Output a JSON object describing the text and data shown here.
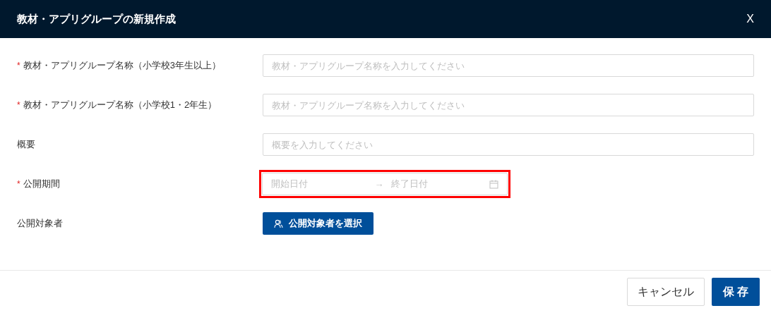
{
  "dialog": {
    "title": "教材・アプリグループの新規作成",
    "close": "X"
  },
  "fields": [
    {
      "kind": "text",
      "required_mark": "*",
      "label": "教材・アプリグループ名称（小学校3年生以上）",
      "placeholder": "教材・アプリグループ名称を入力してください"
    },
    {
      "kind": "text",
      "required_mark": "*",
      "label": "教材・アプリグループ名称（小学校1・2年生）",
      "placeholder": "教材・アプリグループ名称を入力してください"
    },
    {
      "kind": "text",
      "label": "概要",
      "placeholder": "概要を入力してください"
    },
    {
      "kind": "daterange",
      "required_mark": "*",
      "label": "公開期間",
      "start_placeholder": "開始日付",
      "separator": "→",
      "end_placeholder": "終了日付",
      "error": true
    },
    {
      "kind": "button",
      "label": "公開対象者",
      "button": "公開対象者を選択"
    }
  ],
  "footer": {
    "cancel": "キャンセル",
    "save": "保 存"
  }
}
